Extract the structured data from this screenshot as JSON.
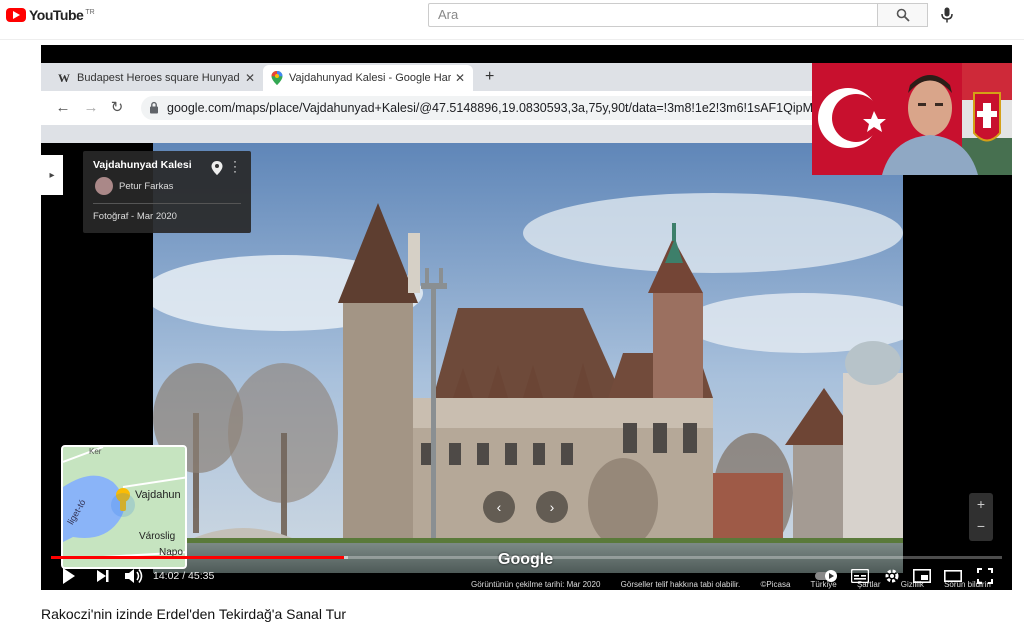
{
  "masthead": {
    "logo_text": "YouTube",
    "region": "TR",
    "search_placeholder": "Ara"
  },
  "browser": {
    "tabs": [
      {
        "title": "Budapest Heroes square Hunyad",
        "active": false,
        "favicon": "wikipedia-w"
      },
      {
        "title": "Vajdahunyad Kalesi - Google Har",
        "active": true,
        "favicon": "maps-pin"
      }
    ],
    "url": "google.com/maps/place/Vajdahunyad+Kalesi/@47.5148896,19.0830593,3a,75y,90t/data=!3m8!1e2!3m6!1sAF1QipMKI"
  },
  "map": {
    "info_card": {
      "place": "Vajdahunyad Kalesi",
      "author": "Petur Farkas",
      "photo_date": "Fotoğraf - Mar 2020"
    },
    "minimap_labels": [
      "Vajdahun",
      "Városlig",
      "Napo",
      "liget-tó",
      "Ker"
    ],
    "watermark": "Google",
    "attribution": [
      "Görüntünün çekilme tarihi: Mar 2020",
      "Görseller telif hakkına tabi olabilir.",
      "©Picasa",
      "Türkiye",
      "Şartlar",
      "Gizlilik",
      "Sorun bildirin"
    ]
  },
  "player": {
    "current_time": "14:02",
    "duration": "45:35",
    "time_display": "14:02 / 45:35",
    "played_fraction": 0.308,
    "loaded_fraction": 0.312
  },
  "video": {
    "title": "Rakoczi'nin izinde Erdel'den Tekirdağ'a Sanal Tur"
  },
  "colors": {
    "yt_red": "#ff0000",
    "tab_bar": "#dee1e6"
  }
}
